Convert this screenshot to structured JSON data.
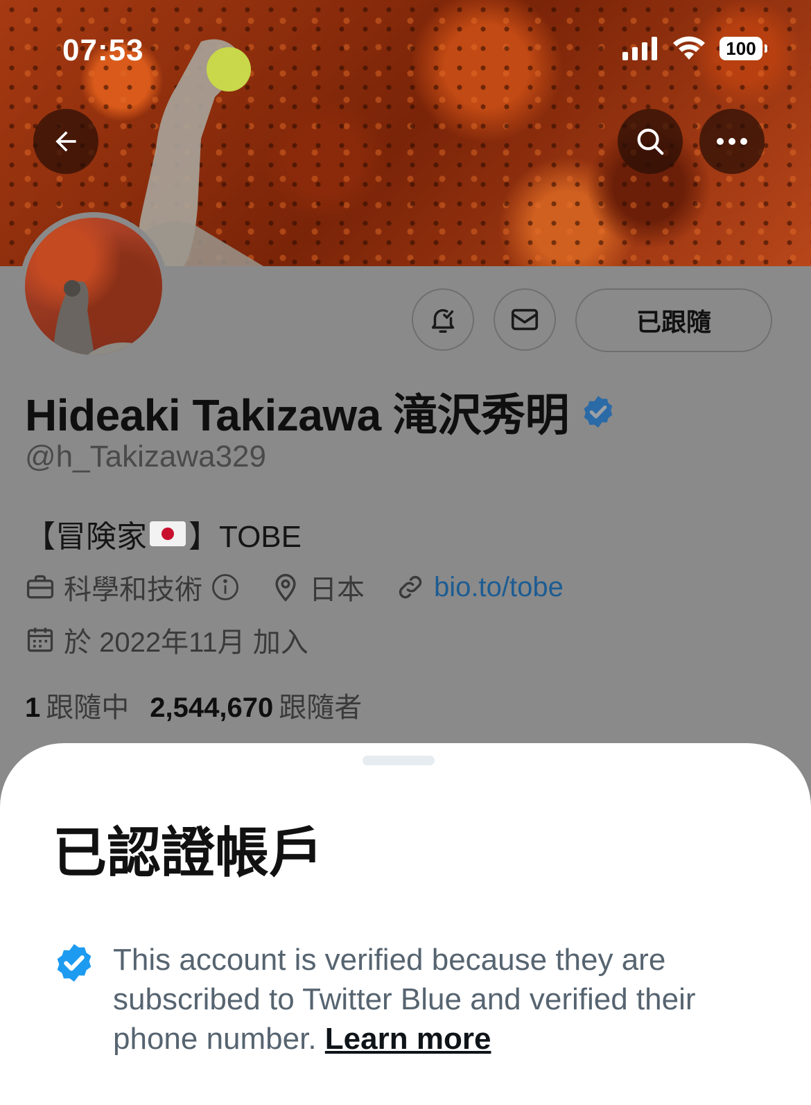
{
  "status_bar": {
    "time": "07:53",
    "battery": "100"
  },
  "profile": {
    "name": "Hideaki Takizawa 滝沢秀明",
    "handle": "@h_Takizawa329",
    "bio_prefix": "【冒険家",
    "bio_suffix": "】TOBE",
    "category": "科學和技術",
    "location": "日本",
    "link": "bio.to/tobe",
    "joined": "於 2022年11月 加入",
    "following_count": "1",
    "following_label": "跟隨中",
    "followers_count": "2,544,670",
    "followers_label": "跟隨者",
    "follow_button_label": "已跟隨"
  },
  "sheet": {
    "title": "已認證帳戶",
    "description": "This account is verified because they are subscribed to Twitter Blue and verified their phone number.",
    "learn_more": "Learn more"
  },
  "colors": {
    "verified": "#1d9bf0",
    "link": "#1d5c92"
  },
  "icons": [
    "back-arrow-icon",
    "search-icon",
    "more-icon",
    "signal-icon",
    "wifi-icon",
    "bell-icon",
    "mail-icon",
    "verified-badge-icon",
    "briefcase-icon",
    "info-icon",
    "location-icon",
    "link-icon",
    "calendar-icon"
  ]
}
